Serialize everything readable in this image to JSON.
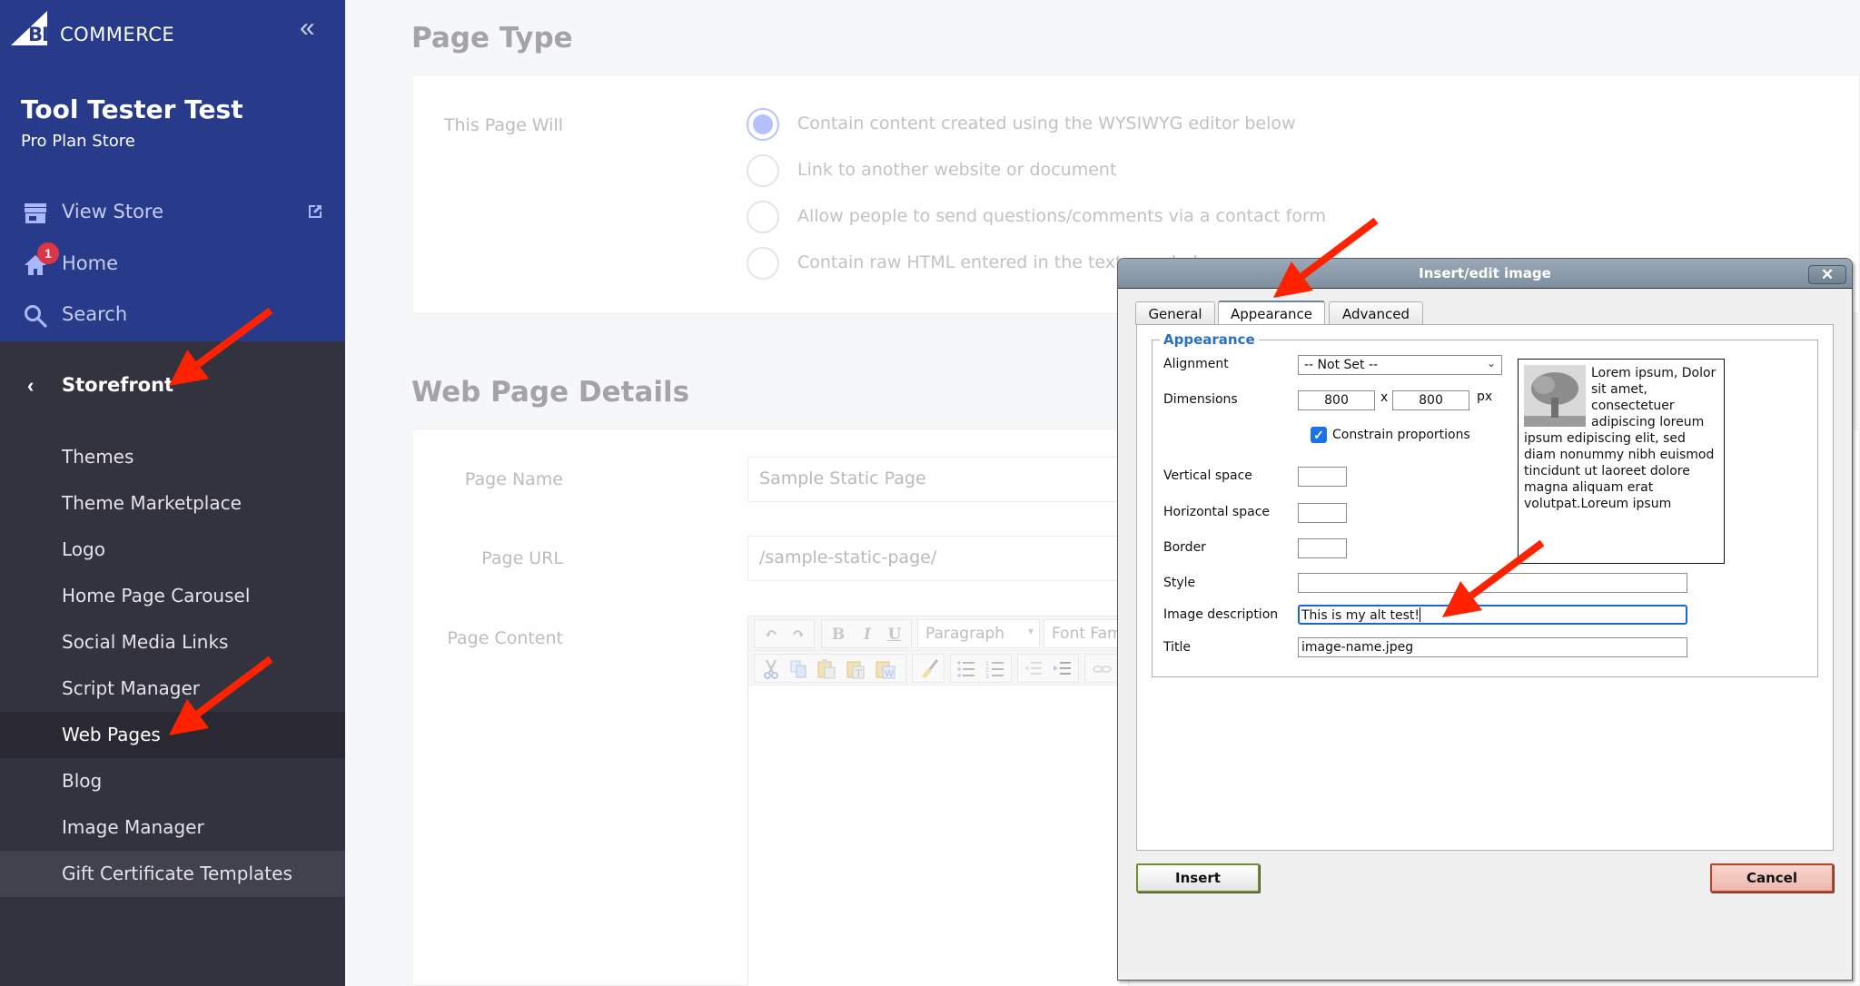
{
  "sidebar": {
    "brand": {
      "big": "BIG",
      "rest": "COMMERCE"
    },
    "collapse_glyph": "«",
    "store_name": "Tool Tester Test",
    "store_plan": "Pro Plan Store",
    "top_links": [
      {
        "label": "View Store",
        "icon": "storefront-icon",
        "trailing_icon": "external-link-icon"
      },
      {
        "label": "Home",
        "icon": "home-icon",
        "badge": "1"
      },
      {
        "label": "Search",
        "icon": "search-icon"
      }
    ],
    "section": {
      "back_glyph": "‹",
      "title": "Storefront"
    },
    "sub_items": [
      {
        "label": "Themes"
      },
      {
        "label": "Theme Marketplace"
      },
      {
        "label": "Logo"
      },
      {
        "label": "Home Page Carousel"
      },
      {
        "label": "Social Media Links"
      },
      {
        "label": "Script Manager"
      },
      {
        "label": "Web Pages",
        "active": true
      },
      {
        "label": "Blog"
      },
      {
        "label": "Image Manager"
      },
      {
        "label": "Gift Certificate Templates",
        "hover": true
      }
    ]
  },
  "page_type": {
    "heading": "Page Type",
    "label": "This Page Will",
    "options": [
      {
        "label": "Contain content created using the WYSIWYG editor below",
        "selected": true
      },
      {
        "label": "Link to another website or document",
        "selected": false
      },
      {
        "label": "Allow people to send questions/comments via a contact form",
        "selected": false
      },
      {
        "label": "Contain raw HTML entered in the text area below",
        "selected": false
      }
    ]
  },
  "details": {
    "heading": "Web Page Details",
    "page_name_label": "Page Name",
    "page_name_value": "Sample Static Page",
    "page_url_label": "Page URL",
    "page_url_value": "/sample-static-page/",
    "page_content_label": "Page Content",
    "editor": {
      "undo": "↶",
      "redo": "↷",
      "bold": "B",
      "italic": "I",
      "underline": "U",
      "format_select": "Paragraph",
      "format_caret": "▾",
      "font_select": "Font Family",
      "row2_icons": [
        "cut-icon",
        "copy-icon",
        "paste-icon",
        "paste-text-icon",
        "paste-word-icon",
        "cleanup-icon",
        "bullet-list-icon",
        "numbered-list-icon",
        "outdent-icon",
        "indent-icon",
        "link-icon"
      ]
    }
  },
  "dialog": {
    "title": "Insert/edit image",
    "close_glyph": "✕",
    "tabs": [
      {
        "label": "General",
        "active": false
      },
      {
        "label": "Appearance",
        "active": true
      },
      {
        "label": "Advanced",
        "active": false
      }
    ],
    "legend": "Appearance",
    "alignment_label": "Alignment",
    "alignment_value": "-- Not Set --",
    "dimensions_label": "Dimensions",
    "width_value": "800",
    "times": "x",
    "height_value": "800",
    "unit": "px",
    "constrain_label": "Constrain proportions",
    "constrain_checked": true,
    "vspace_label": "Vertical space",
    "vspace_value": "",
    "hspace_label": "Horizontal space",
    "hspace_value": "",
    "border_label": "Border",
    "border_value": "",
    "style_label": "Style",
    "style_value": "",
    "description_label": "Image description",
    "description_value": "This is my alt test!",
    "title_label": "Title",
    "title_value": "image-name.jpeg",
    "preview_text": "Lorem ipsum, Dolor sit amet, consectetuer adipiscing loreum ipsum edipiscing elit, sed diam nonummy nibh euismod tincidunt ut laoreet dolore magna aliquam erat volutpat.Loreum ipsum",
    "insert_label": "Insert",
    "cancel_label": "Cancel"
  },
  "colors": {
    "sidebar_header": "#283a8a",
    "sidebar_body": "#33323f",
    "badge": "#db3643",
    "annotation_arrow": "#ff2200",
    "dialog_legend": "#2b6fbd",
    "focus_ring": "#1a66d2"
  }
}
